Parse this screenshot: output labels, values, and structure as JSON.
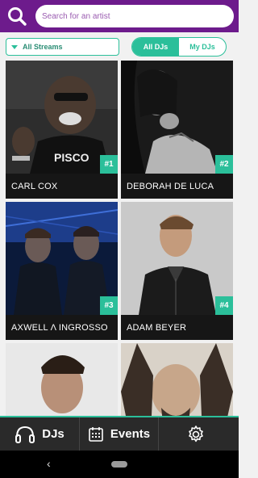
{
  "header": {
    "search_placeholder": "Search for an artist",
    "accent": "#6d1b8c"
  },
  "filters": {
    "stream_label": "All Streams",
    "segment": [
      {
        "label": "All DJs",
        "active": true
      },
      {
        "label": "My DJs",
        "active": false
      }
    ],
    "accent": "#2bbf9a"
  },
  "djs": [
    {
      "name": "CARL COX",
      "rank": "#1"
    },
    {
      "name": "DEBORAH DE LUCA",
      "rank": "#2"
    },
    {
      "name": "AXWELL Λ INGROSSO",
      "rank": "#3"
    },
    {
      "name": "ADAM BEYER",
      "rank": "#4"
    },
    {
      "name": "",
      "rank": ""
    },
    {
      "name": "",
      "rank": ""
    }
  ],
  "tabbar": {
    "djs_label": "DJs",
    "events_label": "Events",
    "settings_icon": "gear-icon"
  },
  "android_nav": {
    "back_icon": "back-chevron-icon",
    "home_icon": "home-pill-icon"
  }
}
